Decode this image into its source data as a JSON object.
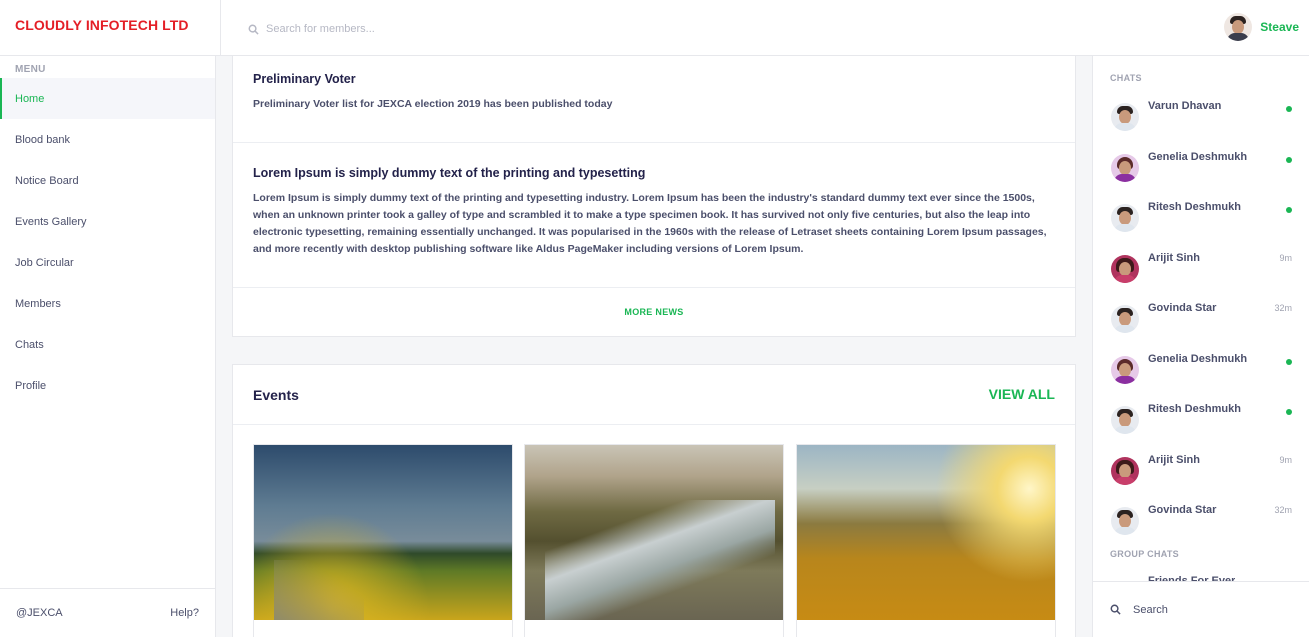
{
  "brand": {
    "name": "CLOUDLY INFOTECH LTD",
    "color": "#e41e26"
  },
  "header": {
    "search_placeholder": "Search for members...",
    "user_name": "Steave",
    "icons": {
      "search": "search-icon",
      "avatar": "user-avatar"
    }
  },
  "colors": {
    "accent": "#1ab654",
    "text": "#2d2b4e",
    "muted": "#a0a3b1"
  },
  "sidebar": {
    "menu_label": "MENU",
    "items": [
      {
        "label": "Home",
        "active": true
      },
      {
        "label": "Blood bank"
      },
      {
        "label": "Notice Board"
      },
      {
        "label": "Events Gallery"
      },
      {
        "label": "Job Circular"
      },
      {
        "label": "Members"
      },
      {
        "label": "Chats"
      },
      {
        "label": "Profile"
      }
    ],
    "footer_left": "@JEXCA",
    "footer_right": "Help?"
  },
  "news": {
    "items": [
      {
        "title": "Preliminary Voter",
        "text": "Preliminary Voter list for JEXCA election 2019 has been published today"
      },
      {
        "title": "Lorem Ipsum is simply dummy text of the printing and typesetting",
        "text": "Lorem Ipsum is simply dummy text of the printing and typesetting industry. Lorem Ipsum has been the industry's standard dummy text ever since the 1500s, when an unknown printer took a galley of type and scrambled it to make a type specimen book. It has survived not only five centuries, but also the leap into electronic typesetting, remaining essentially unchanged. It was popularised in the 1960s with the release of Letraset sheets containing Lorem Ipsum passages, and more recently with desktop publishing software like Aldus PageMaker including versions of Lorem Ipsum."
      }
    ],
    "more_label": "MORE NEWS"
  },
  "events": {
    "title": "Events",
    "view_all": "VIEW ALL",
    "images": [
      "sunflower-field-photo",
      "mountain-river-photo",
      "golden-hills-photo"
    ]
  },
  "chats": {
    "label": "CHATS",
    "items": [
      {
        "name": "Varun Dhavan",
        "status": "online"
      },
      {
        "name": "Genelia Deshmukh",
        "status": "online"
      },
      {
        "name": "Ritesh Deshmukh",
        "status": "online"
      },
      {
        "name": "Arijit Sinh",
        "time": "9m"
      },
      {
        "name": "Govinda Star",
        "time": "32m"
      },
      {
        "name": "Genelia Deshmukh",
        "status": "online"
      },
      {
        "name": "Ritesh Deshmukh",
        "status": "online"
      },
      {
        "name": "Arijit Sinh",
        "time": "9m"
      },
      {
        "name": "Govinda Star",
        "time": "32m"
      }
    ],
    "group_label": "GROUP CHATS",
    "group_peek": "Friends For Ever",
    "search_placeholder": "Search"
  }
}
